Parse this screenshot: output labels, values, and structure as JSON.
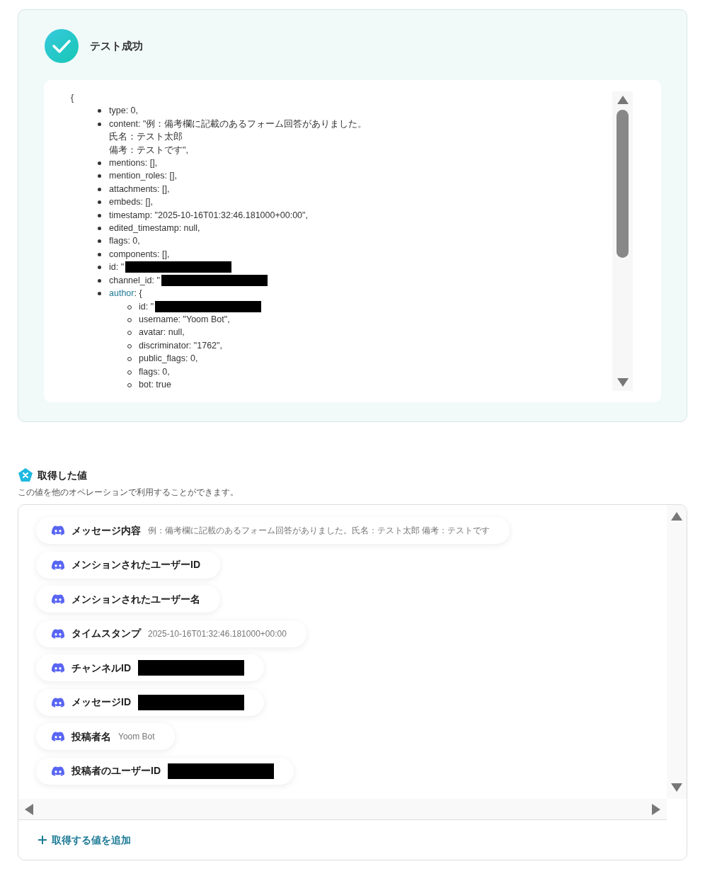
{
  "result": {
    "title": "テスト成功",
    "open_brace": "{",
    "items": [
      {
        "key": "type",
        "lines": [
          ": 0,"
        ]
      },
      {
        "key": "content",
        "lines": [
          ": \"例：備考欄に記載のあるフォーム回答がありました。",
          "氏名：テスト太郎",
          "備考：テストです\","
        ]
      },
      {
        "key": "mentions",
        "lines": [
          ": [],"
        ]
      },
      {
        "key": "mention_roles",
        "lines": [
          ": [],"
        ]
      },
      {
        "key": "attachments",
        "lines": [
          ": [],"
        ]
      },
      {
        "key": "embeds",
        "lines": [
          ": [],"
        ]
      },
      {
        "key": "timestamp",
        "lines": [
          ": \"2025-10-16T01:32:46.181000+00:00\","
        ]
      },
      {
        "key": "edited_timestamp",
        "lines": [
          ": null,"
        ]
      },
      {
        "key": "flags",
        "lines": [
          ": 0,"
        ]
      },
      {
        "key": "components",
        "lines": [
          ": [],"
        ]
      },
      {
        "key": "id",
        "lines": [
          ": \""
        ],
        "redacted": true
      },
      {
        "key": "channel_id",
        "lines": [
          ": \""
        ],
        "redacted": true
      },
      {
        "key": "author",
        "lines": [
          ": {"
        ],
        "children": [
          {
            "key": "id",
            "lines": [
              ": \""
            ],
            "redacted": true
          },
          {
            "key": "username",
            "lines": [
              ": \"Yoom Bot\","
            ]
          },
          {
            "key": "avatar",
            "lines": [
              ": null,"
            ]
          },
          {
            "key": "discriminator",
            "lines": [
              ": \"1762\","
            ]
          },
          {
            "key": "public_flags",
            "lines": [
              ": 0,"
            ]
          },
          {
            "key": "flags",
            "lines": [
              ": 0,"
            ]
          },
          {
            "key": "bot",
            "lines": [
              ": true"
            ]
          }
        ]
      }
    ]
  },
  "values": {
    "title": "取得した値",
    "subtitle": "この値を他のオペレーションで利用することができます。",
    "pills": [
      {
        "label": "メッセージ内容",
        "kind": "text",
        "value": "例：備考欄に記載のあるフォーム回答がありました。氏名：テスト太郎 備考：テストです"
      },
      {
        "label": "メンションされたユーザーID",
        "kind": "empty"
      },
      {
        "label": "メンションされたユーザー名",
        "kind": "empty"
      },
      {
        "label": "タイムスタンプ",
        "kind": "text",
        "value": "2025-10-16T01:32:46.181000+00:00"
      },
      {
        "label": "チャンネルID",
        "kind": "redacted"
      },
      {
        "label": "メッセージID",
        "kind": "redacted"
      },
      {
        "label": "投稿者名",
        "kind": "text",
        "value": "Yoom Bot"
      },
      {
        "label": "投稿者のユーザーID",
        "kind": "redacted"
      }
    ],
    "add_label": "取得する値を追加"
  }
}
